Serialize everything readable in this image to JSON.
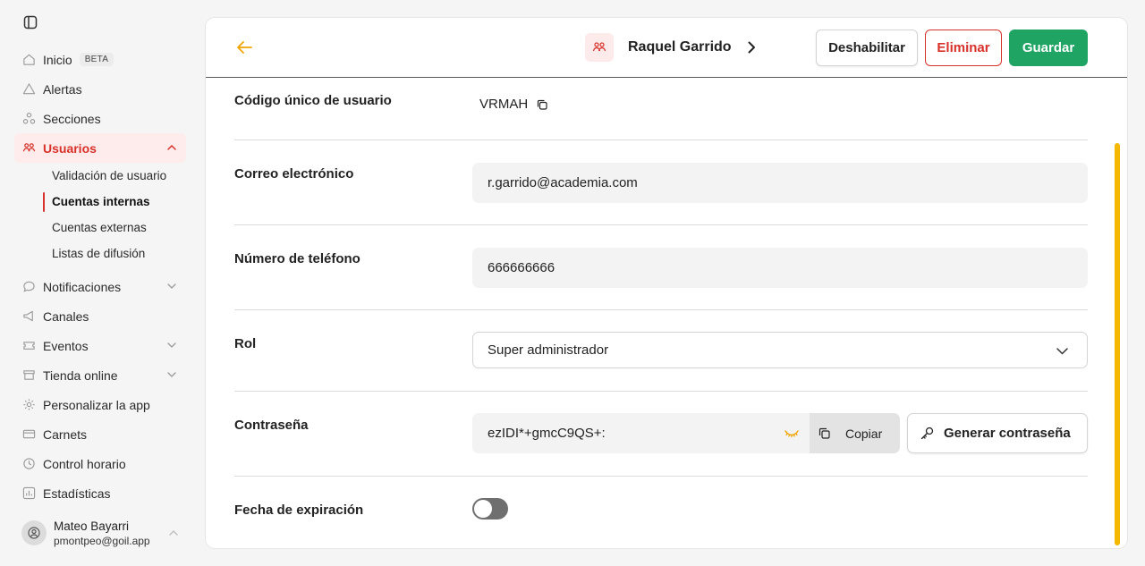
{
  "sidebar": {
    "items": [
      {
        "label": "Inicio",
        "badge": "BETA"
      },
      {
        "label": "Alertas"
      },
      {
        "label": "Secciones"
      },
      {
        "label": "Usuarios"
      },
      {
        "label": "Notificaciones"
      },
      {
        "label": "Canales"
      },
      {
        "label": "Eventos"
      },
      {
        "label": "Tienda online"
      },
      {
        "label": "Personalizar la app"
      },
      {
        "label": "Carnets"
      },
      {
        "label": "Control horario"
      },
      {
        "label": "Estadísticas"
      }
    ],
    "usuarios_sub": [
      {
        "label": "Validación de usuario"
      },
      {
        "label": "Cuentas internas"
      },
      {
        "label": "Cuentas externas"
      },
      {
        "label": "Listas de difusión"
      }
    ],
    "user": {
      "name": "Mateo Bayarri",
      "email": "pmontpeo@goil.app"
    }
  },
  "header": {
    "user_name": "Raquel Garrido",
    "disable_label": "Deshabilitar",
    "delete_label": "Eliminar",
    "save_label": "Guardar"
  },
  "form": {
    "code": {
      "label": "Código único de usuario",
      "value": "VRMAH"
    },
    "email": {
      "label": "Correo electrónico",
      "value": "r.garrido@academia.com"
    },
    "phone": {
      "label": "Número de teléfono",
      "value": "666666666"
    },
    "role": {
      "label": "Rol",
      "value": "Super administrador"
    },
    "password": {
      "label": "Contraseña",
      "value": "ezIDI*+gmcC9QS+:",
      "copy_label": "Copiar",
      "generate_label": "Generar contraseña"
    },
    "expiration": {
      "label": "Fecha de expiración",
      "enabled": false
    }
  },
  "colors": {
    "accent_red": "#d8312b",
    "save_green": "#1fa463",
    "scroll_yellow": "#f5b800",
    "back_arrow": "#f0a500"
  }
}
